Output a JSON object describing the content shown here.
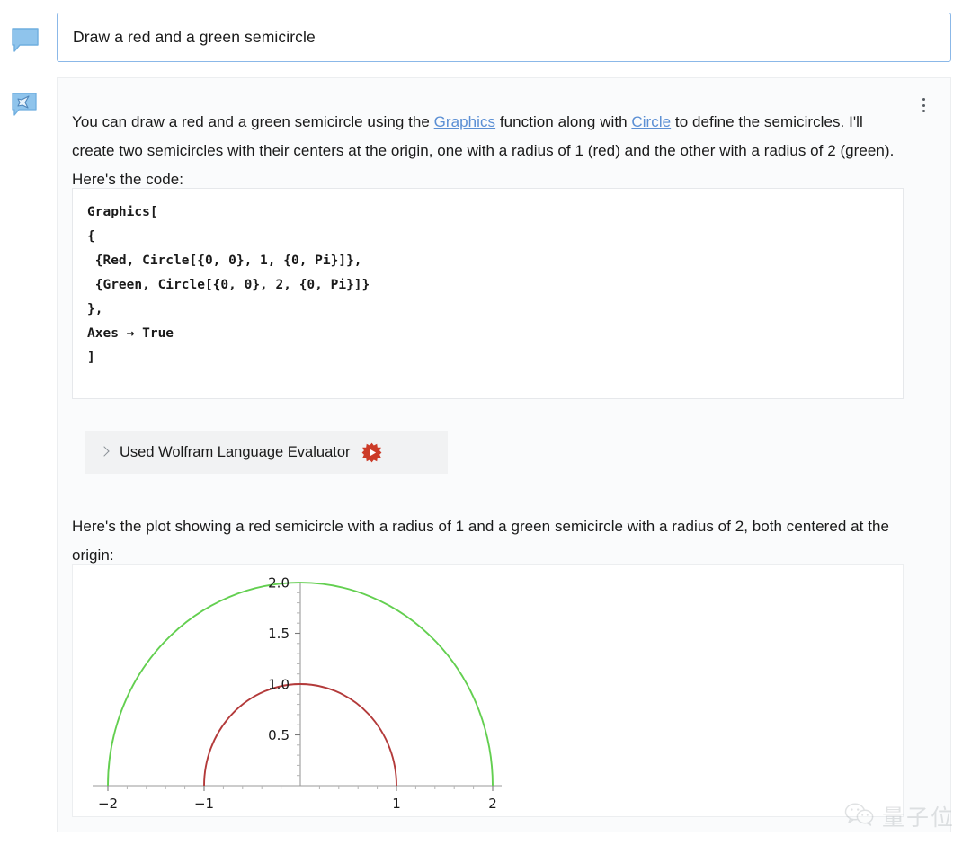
{
  "prompt": {
    "text": "Draw a red and a green semicircle",
    "icon": "speech-bubble-icon"
  },
  "response": {
    "icon": "wolfram-assistant-icon",
    "paragraph_1_part_1": "You can draw a red and a green semicircle using the ",
    "link_graphics": "Graphics",
    "paragraph_1_part_2": " function along with ",
    "link_circle": "Circle",
    "paragraph_1_part_3": " to define the semicircles. I'll create two semicircles with their centers at the origin, one with a radius of 1 (red) and the other with a radius of 2 (green). Here's the code:",
    "paragraph_2": "Here's the plot showing a red semicircle with a radius of 1 and a green semicircle with a radius of 2, both centered at the origin:",
    "menu_icon": "kebab-menu-icon"
  },
  "code": {
    "language": "Wolfram Language",
    "content": "Graphics[\n{\n {Red, Circle[{0, 0}, 1, {0, Pi}]},\n {Green, Circle[{0, 0}, 2, {0, Pi}]}\n},\nAxes → True\n]"
  },
  "tool": {
    "label": "Used Wolfram Language Evaluator",
    "chevron_icon": "chevron-right-icon",
    "badge_icon": "wolfram-spikey-icon",
    "badge_color": "#cc3b28"
  },
  "watermark": {
    "text": "量子位",
    "icon": "wechat-icon"
  },
  "colors": {
    "red_curve": "#b33a3a",
    "green_curve": "#63cf50",
    "axis": "#9a9a9a",
    "link": "#5b8fd4",
    "prompt_border": "#8bb8e8",
    "icon_fill": "#8fc4ec"
  },
  "chart_data": {
    "type": "line",
    "title": "",
    "xlabel": "",
    "ylabel": "",
    "xlim": [
      -2.15,
      2.15
    ],
    "ylim": [
      0,
      2.08
    ],
    "grid": false,
    "axes": true,
    "legend": null,
    "x_ticks": [
      -2,
      -1,
      1,
      2
    ],
    "x_tick_labels": [
      "-2",
      "-1",
      "1",
      "2"
    ],
    "y_ticks": [
      0.5,
      1.0,
      1.5,
      2.0
    ],
    "y_tick_labels": [
      "0.5",
      "1.0",
      "1.5",
      "2.0"
    ],
    "x_minor_tick_step": 0.2,
    "y_minor_tick_step": 0.1,
    "series": [
      {
        "name": "red semicircle",
        "shape": "semicircle",
        "center": [
          0,
          0
        ],
        "radius": 1,
        "angle_range_deg": [
          0,
          180
        ],
        "color": "#b33a3a"
      },
      {
        "name": "green semicircle",
        "shape": "semicircle",
        "center": [
          0,
          0
        ],
        "radius": 2,
        "angle_range_deg": [
          0,
          180
        ],
        "color": "#63cf50"
      }
    ]
  }
}
